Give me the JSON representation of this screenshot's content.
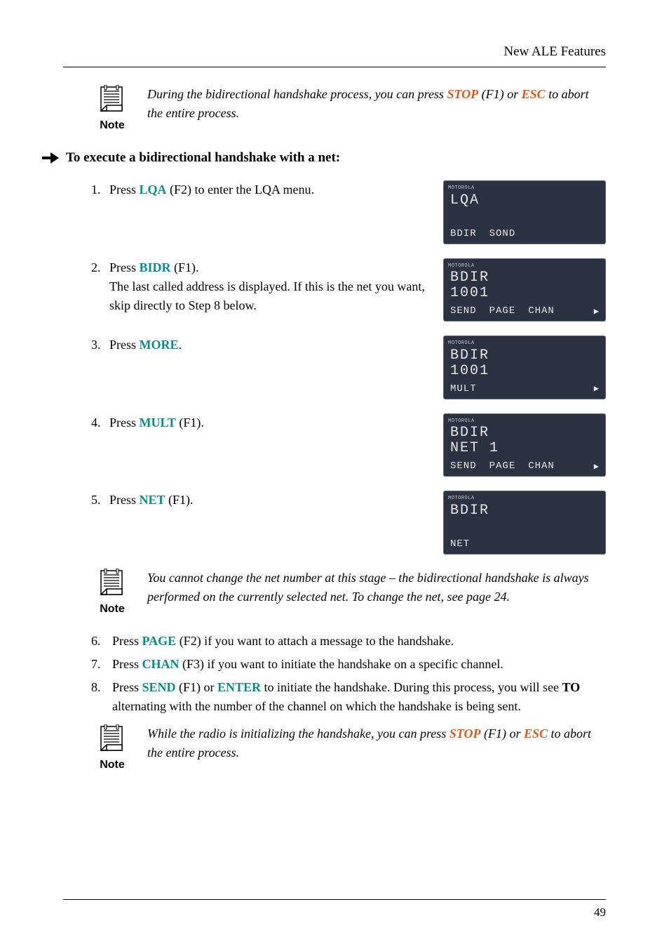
{
  "header": {
    "title": "New ALE Features"
  },
  "note1": {
    "label": "Note",
    "text_pre": "During the bidirectional handshake process, you can press ",
    "stop": "STOP",
    "mid": " (F1) or ",
    "esc": "ESC",
    "post": " to abort the entire process."
  },
  "heading": "To execute a bidirectional handshake with a net:",
  "steps": {
    "s1": {
      "num": "1.",
      "pre": "Press ",
      "key": "LQA",
      "post": " (F2) to enter the LQA menu."
    },
    "s2": {
      "num": "2.",
      "pre": "Press ",
      "key": "BIDR",
      "post": " (F1).",
      "line2": "The last called address is displayed. If this is the net you want, skip directly to Step 8 below."
    },
    "s3": {
      "num": "3.",
      "pre": "Press ",
      "key": "MORE",
      "post": "."
    },
    "s4": {
      "num": "4.",
      "pre": "Press ",
      "key": "MULT",
      "post": " (F1)."
    },
    "s5": {
      "num": "5.",
      "pre": "Press ",
      "key": "NET",
      "post": " (F1)."
    }
  },
  "lcds": {
    "brand": "MOTOROLA",
    "lcd1": {
      "l1": "LQA",
      "l2": "",
      "soft": [
        "BDIR",
        "SOND"
      ],
      "more": false
    },
    "lcd2": {
      "l1": "BDIR",
      "l2": "1001",
      "soft": [
        "SEND",
        "PAGE",
        "CHAN"
      ],
      "more": true
    },
    "lcd3": {
      "l1": "BDIR",
      "l2": "1001",
      "soft": [
        "MULT"
      ],
      "more": true
    },
    "lcd4": {
      "l1": "BDIR",
      "l2": "NET  1",
      "soft": [
        "SEND",
        "PAGE",
        "CHAN"
      ],
      "more": true
    },
    "lcd5": {
      "l1": "BDIR",
      "l2": "",
      "soft": [
        "NET"
      ],
      "more": false
    }
  },
  "note2": {
    "label": "Note",
    "text": "You cannot change the net number at this stage – the bidirectional handshake is always performed on the currently selected net. To change the net, see page 24."
  },
  "lower": {
    "s6": {
      "num": "6.",
      "pre": "Press ",
      "key": "PAGE",
      "post": " (F2) if you want to attach a message to the handshake."
    },
    "s7": {
      "num": "7.",
      "pre": "Press ",
      "key": "CHAN",
      "post": " (F3) if you want to initiate the handshake on a specific channel."
    },
    "s8": {
      "num": "8.",
      "pre": "Press ",
      "key1": "SEND",
      "mid": " (F1) or ",
      "key2": "ENTER",
      "post_a": " to initiate the handshake. During this process, you will see ",
      "bold": "TO",
      "post_b": " alternating with the number of the channel on which the handshake is being sent."
    }
  },
  "note3": {
    "label": "Note",
    "text_pre": "While the radio is initializing the handshake, you can press ",
    "stop": "STOP",
    "mid": " (F1) or ",
    "esc": "ESC",
    "post": " to abort the entire process."
  },
  "pagenum": "49"
}
